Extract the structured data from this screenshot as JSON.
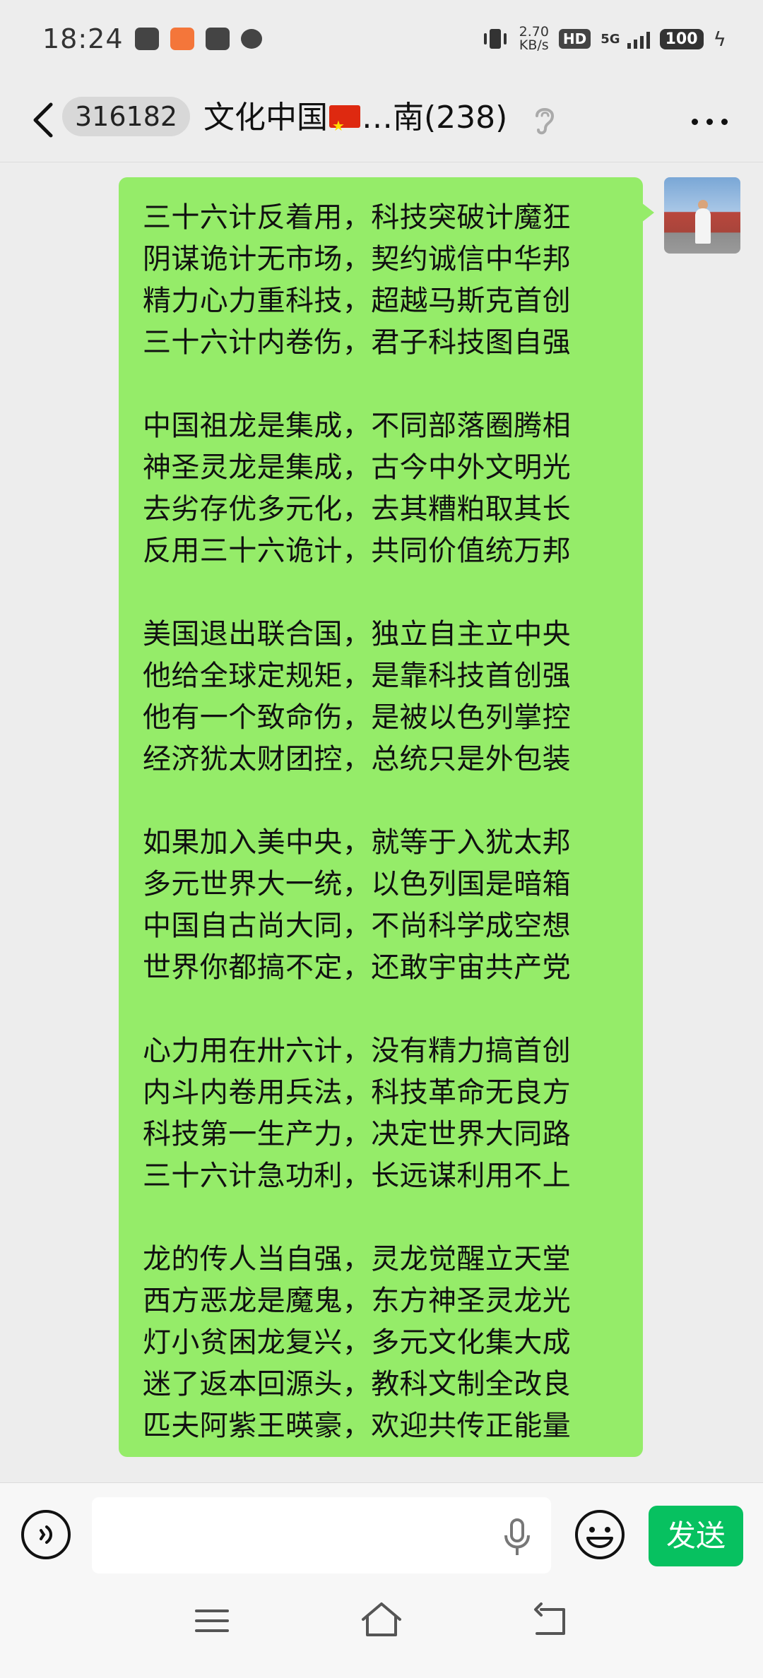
{
  "status_bar": {
    "time": "18:24",
    "net_speed_value": "2.70",
    "net_speed_unit": "KB/s",
    "hd_label": "HD",
    "network_type": "5G",
    "battery": "100"
  },
  "header": {
    "unread_count": "316182",
    "title_part1": "文化中国",
    "title_part2": "…南(238)"
  },
  "message": {
    "stanzas": [
      [
        "三十六计反着用，科技突破计魔狂",
        "阴谋诡计无市场，契约诚信中华邦",
        "精力心力重科技，超越马斯克首创",
        "三十六计内卷伤，君子科技图自强"
      ],
      [
        "中国祖龙是集成，不同部落圈腾相",
        "神圣灵龙是集成，古今中外文明光",
        "去劣存优多元化，去其糟粕取其长",
        "反用三十六诡计，共同价值统万邦"
      ],
      [
        "美国退出联合国，独立自主立中央",
        "他给全球定规矩，是靠科技首创强",
        "他有一个致命伤，是被以色列掌控",
        "经济犹太财团控，总统只是外包装"
      ],
      [
        "如果加入美中央，就等于入犹太邦",
        "多元世界大一统，以色列国是暗箱",
        "中国自古尚大同，不尚科学成空想",
        "世界你都搞不定，还敢宇宙共产党"
      ],
      [
        "心力用在卅六计，没有精力搞首创",
        "内斗内卷用兵法，科技革命无良方",
        "科技第一生产力，决定世界大同路",
        "三十六计急功利，长远谋利用不上"
      ],
      [
        "龙的传人当自强，灵龙觉醒立天堂",
        "西方恶龙是魔鬼，东方神圣灵龙光",
        "灯小贫困龙复兴，多元文化集大成",
        "迷了返本回源头，教科文制全改良",
        "匹夫阿紫王暎豪，欢迎共传正能量"
      ]
    ]
  },
  "input_bar": {
    "send_label": "发送"
  }
}
